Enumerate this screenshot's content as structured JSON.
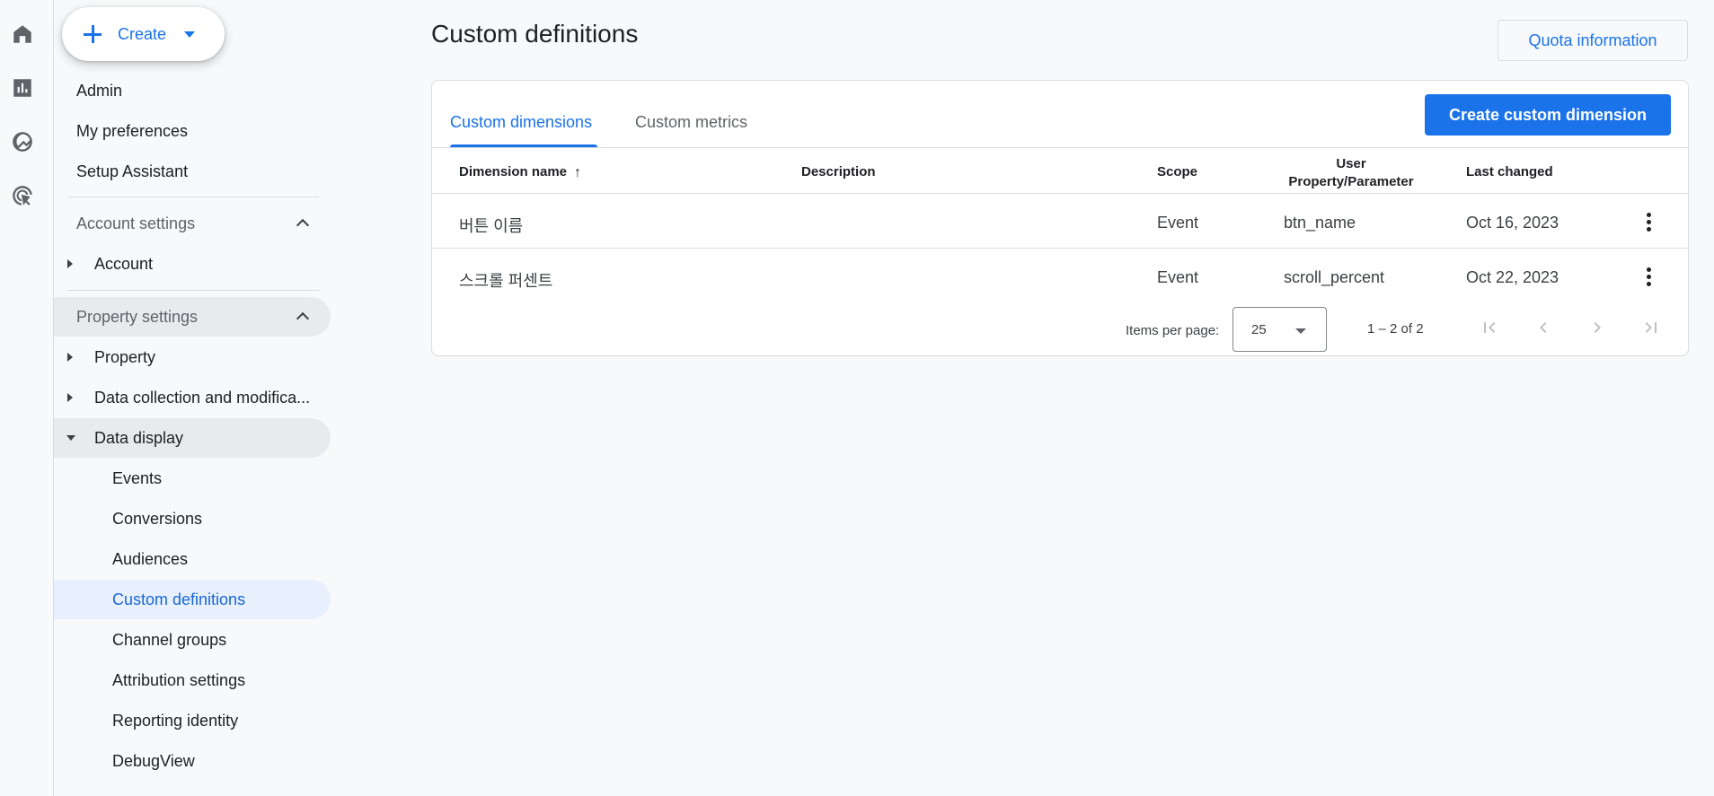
{
  "rail": {
    "icons": [
      "home-icon",
      "reports-icon",
      "explore-icon",
      "advertising-icon"
    ]
  },
  "create": {
    "label": "Create"
  },
  "nav": {
    "admin": "Admin",
    "my_preferences": "My preferences",
    "setup_assistant": "Setup Assistant",
    "account_settings": "Account settings",
    "account": "Account",
    "property_settings": "Property settings",
    "property": "Property",
    "data_collection": "Data collection and modifica...",
    "data_display": "Data display",
    "events": "Events",
    "conversions": "Conversions",
    "audiences": "Audiences",
    "custom_definitions": "Custom definitions",
    "channel_groups": "Channel groups",
    "attribution_settings": "Attribution settings",
    "reporting_identity": "Reporting identity",
    "debugview": "DebugView"
  },
  "header": {
    "title": "Custom definitions",
    "quota_button": "Quota information"
  },
  "tabs": {
    "custom_dimensions": "Custom dimensions",
    "custom_metrics": "Custom metrics",
    "create_button": "Create custom dimension"
  },
  "table": {
    "headers": {
      "dimension_name": "Dimension name",
      "description": "Description",
      "scope": "Scope",
      "user_property_line1": "User",
      "user_property_line2": "Property/Parameter",
      "last_changed": "Last changed"
    },
    "rows": [
      {
        "name": "버튼 이름",
        "description": "",
        "scope": "Event",
        "parameter": "btn_name",
        "last_changed": "Oct 16, 2023"
      },
      {
        "name": "스크롤 퍼센트",
        "description": "",
        "scope": "Event",
        "parameter": "scroll_percent",
        "last_changed": "Oct 22, 2023"
      }
    ]
  },
  "pager": {
    "items_per_page_label": "Items per page:",
    "items_per_page_value": "25",
    "range": "1 – 2 of 2"
  },
  "colors": {
    "accent": "#1a73e8",
    "active_nav_bg": "#e8f0fe",
    "shaded_nav_bg": "#e8eaed"
  }
}
